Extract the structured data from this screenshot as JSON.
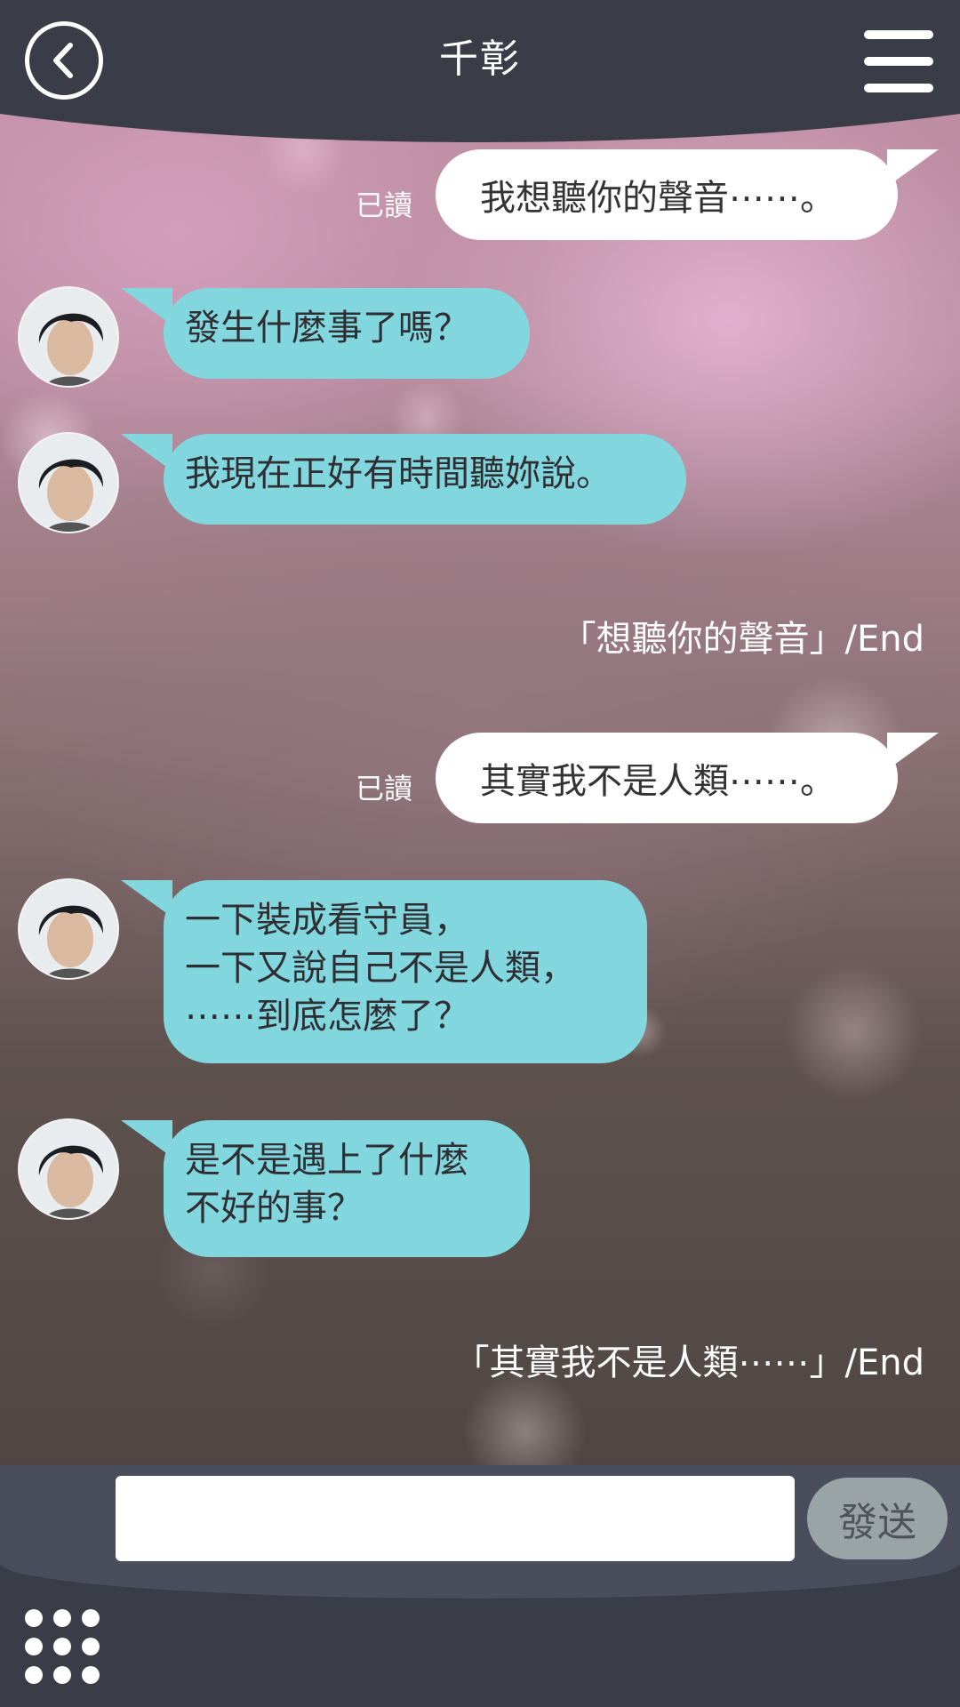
{
  "header": {
    "title": "千彰",
    "back_icon": "back-arrow-icon",
    "menu_icon": "hamburger-menu-icon"
  },
  "messages": [
    {
      "side": "right",
      "text": "我想聽你的聲音⋯⋯。",
      "status": "已讀"
    },
    {
      "side": "left",
      "text": "發生什麼事了嗎？"
    },
    {
      "side": "left",
      "text": "我現在正好有時間聽妳說。"
    },
    {
      "side": "end",
      "text": "「想聽你的聲音」/End"
    },
    {
      "side": "right",
      "text": "其實我不是人類⋯⋯。",
      "status": "已讀"
    },
    {
      "side": "left",
      "text": "一下裝成看守員，\n一下又說自己不是人類，\n⋯⋯到底怎麼了？"
    },
    {
      "side": "left",
      "text": "是不是遇上了什麼\n不好的事？"
    },
    {
      "side": "end",
      "text": "「其實我不是人類⋯⋯」/End"
    }
  ],
  "input": {
    "value": "",
    "placeholder": "",
    "send_label": "發送"
  },
  "colors": {
    "header_bg": "#3a3d47",
    "left_bubble": "#82d7de",
    "right_bubble": "#ffffff",
    "send_button": "#9aa4a6"
  },
  "grid_icon": "app-grid-icon"
}
